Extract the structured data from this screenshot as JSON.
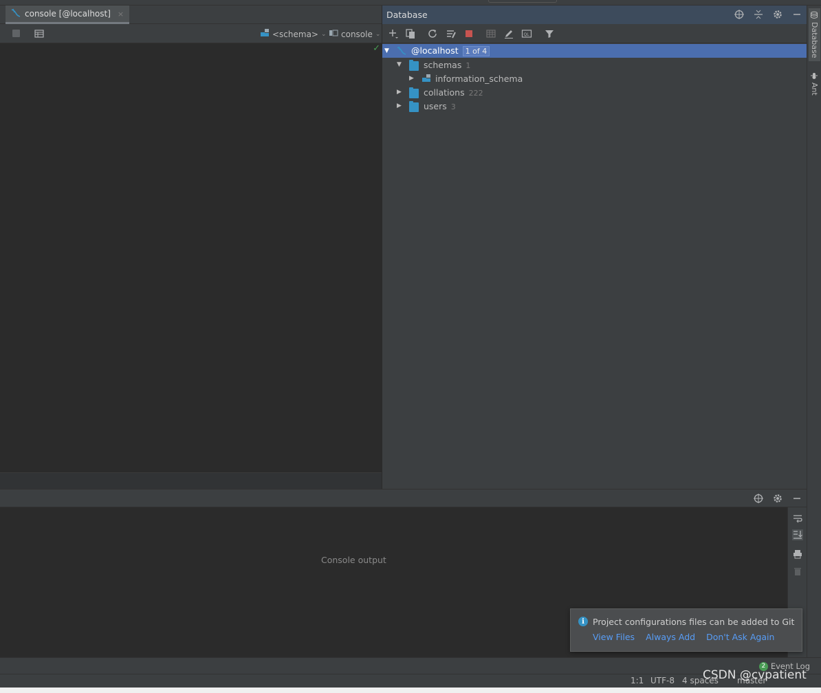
{
  "editor": {
    "tab_label": "console [@localhost]",
    "close_glyph": "×",
    "schema_dropdown": "<schema>",
    "console_dropdown": "console"
  },
  "database": {
    "title": "Database",
    "tree": [
      {
        "label": "@localhost",
        "badge": "1 of 4",
        "icon": "datasource-icon",
        "expanded": true,
        "selected": true
      },
      {
        "label": "schemas",
        "count": "1",
        "icon": "folder-icon",
        "expanded": true
      },
      {
        "label": "information_schema",
        "icon": "schema-icon",
        "expanded": false
      },
      {
        "label": "collations",
        "count": "222",
        "icon": "folder-icon",
        "expanded": false
      },
      {
        "label": "users",
        "count": "3",
        "icon": "folder-icon",
        "expanded": false
      }
    ]
  },
  "side_tabs": {
    "database": "Database",
    "ant": "Ant"
  },
  "run": {
    "placeholder": "Console output"
  },
  "notification": {
    "message": "Project configurations files can be added to Git",
    "links": [
      "View Files",
      "Always Add",
      "Don't Ask Again"
    ]
  },
  "event_log": {
    "count": "2",
    "label": "Event Log"
  },
  "status": {
    "position": "1:1",
    "encoding": "UTF-8",
    "indent": "4 spaces",
    "branch": "master"
  },
  "watermark": "CSDN @cvpatient",
  "colors": {
    "selection": "#4b6eaf",
    "folder": "#3592c4",
    "link": "#589df6",
    "panel": "#3c3f41",
    "editor": "#2b2b2b"
  }
}
